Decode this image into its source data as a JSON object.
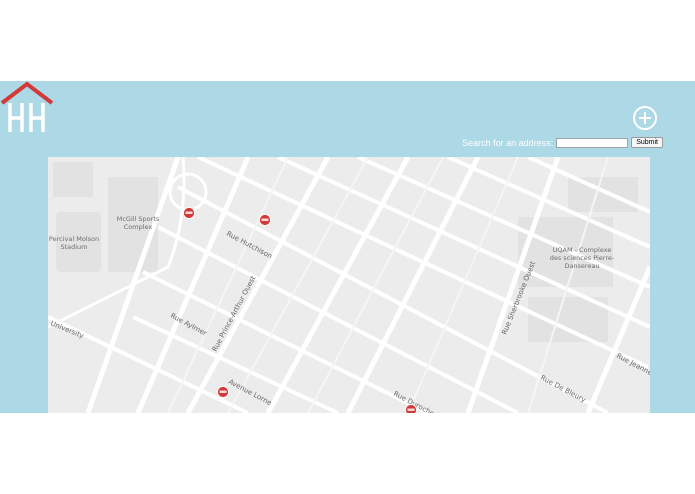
{
  "app": {
    "logo_icon": "house-hh-logo-icon",
    "accent_color": "#d23a3a",
    "band_color": "#add8e6"
  },
  "header": {
    "add_icon": "plus-circle-icon",
    "search_label": "Search for an address:",
    "search_value": "",
    "submit_label": "Submit"
  },
  "map": {
    "pins_icon": "map-marker-icon",
    "places": {
      "mcgill": "McGill Sports Complex",
      "percival": "Percival Molson Stadium",
      "uqam": "UQAM - Complexe des sciences Pierre-Dansereau"
    },
    "places_lines": {
      "mcgill_1": "McGill Sports",
      "mcgill_2": "Complex",
      "percival_1": "Percival Molson",
      "percival_2": "Stadium",
      "uqam_1": "UQAM - Complexe",
      "uqam_2": "des sciences Pierre-",
      "uqam_3": "Dansereau"
    },
    "streets": {
      "hutchison": "Rue Hutchison",
      "prince_arthur": "Rue Prince-Arthur Ouest",
      "aylmer": "Rue Aylmer",
      "lorne": "Avenue Lorne",
      "sherbrooke": "Rue Sherbrooke Ouest",
      "de_bleury": "Rue De Bleury",
      "jeanne": "Rue Jeanne-",
      "university": "University",
      "durocher": "Rue Durocher"
    }
  }
}
